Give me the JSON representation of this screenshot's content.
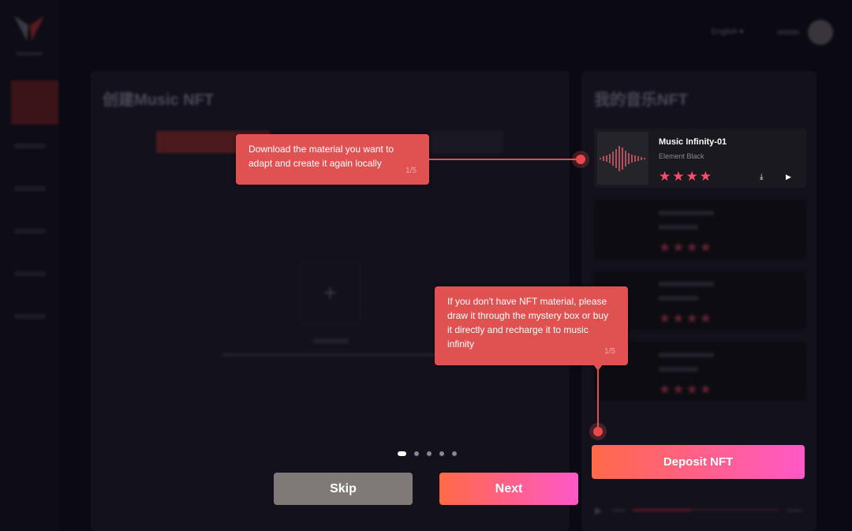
{
  "header": {
    "language": "English",
    "language_chevron": "chevron-down-icon"
  },
  "left_panel": {
    "title": "创建Music NFT"
  },
  "right_panel": {
    "title": "我的音乐NFT",
    "cards": [
      {
        "title": "Music Infinity-01",
        "artist": "Element Black",
        "stars": 4
      }
    ],
    "deposit_label": "Deposit NFT"
  },
  "tour": {
    "tip1": {
      "text": "Download the material you want to adapt and create it again locally",
      "count": "1/5"
    },
    "tip2": {
      "text": "If you don't have NFT material, please draw it through the mystery box or buy it directly and recharge it to music infinity",
      "count": "1/5"
    },
    "skip_label": "Skip",
    "next_label": "Next",
    "steps_total": 5,
    "step_active": 1
  },
  "colors": {
    "accent": "#e05252",
    "gradient_start": "#ff6a48",
    "gradient_end": "#ff58c8",
    "star": "#ff4d6a"
  }
}
